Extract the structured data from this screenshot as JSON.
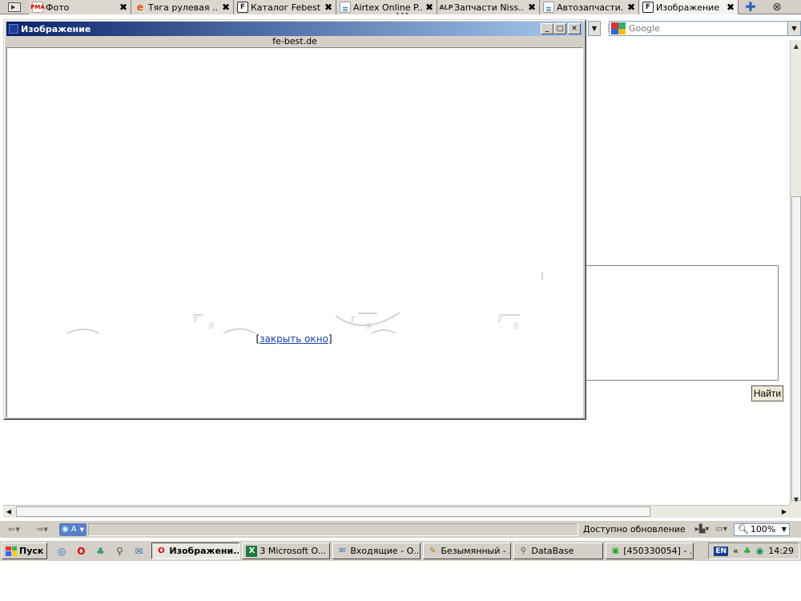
{
  "tabs": [
    {
      "icon": "pma-icon",
      "icon_text": "PMA",
      "label": "Фото",
      "width": 0
    },
    {
      "icon": "ie-icon",
      "icon_text": "e",
      "label": "Тяга рулевая ..."
    },
    {
      "icon": "febest-icon",
      "icon_text": "F",
      "label": "Каталог Febest"
    },
    {
      "icon": "document-icon",
      "icon_text": "",
      "label": "Airtex Online P..."
    },
    {
      "icon": "alp-icon",
      "icon_text": "ALP",
      "label": "Запчасти Niss..."
    },
    {
      "icon": "document-icon",
      "icon_text": "",
      "label": "Автозапчасти..."
    },
    {
      "icon": "febest-icon",
      "icon_text": "F",
      "label": "Изображение"
    }
  ],
  "tab_close_glyph": "✖",
  "tab_add_glyph": "✚",
  "tab_menu_glyph": "⊗",
  "tab_dots": "•••",
  "search": {
    "value": "Google"
  },
  "popup": {
    "title": "Изображение",
    "url": "fe-best.de",
    "link_open": "[",
    "link_text": "закрыть окно",
    "link_close": "]"
  },
  "page": {
    "find_button": "Найти"
  },
  "statusbar": {
    "mode_label": "A",
    "update_text": "Доступно обновление",
    "zoom": "100%"
  },
  "taskbar": {
    "start_label": "Пуск",
    "tasks": [
      {
        "icon": "opera-icon",
        "icon_text": "O",
        "label": "Изображени...",
        "active": true
      },
      {
        "icon": "excel-icon",
        "icon_text": "X",
        "label": "3 Microsoft O... ▾",
        "active": false
      },
      {
        "icon": "mail-icon",
        "icon_text": "✉",
        "label": "Входящие - О...",
        "active": false
      },
      {
        "icon": "paint-icon",
        "icon_text": "✎",
        "label": "Безымянный - ...",
        "active": false
      },
      {
        "icon": "database-icon",
        "icon_text": "⚲",
        "label": "DataBase",
        "active": false
      },
      {
        "icon": "app-icon",
        "icon_text": "▣",
        "label": "[450330054] - ...",
        "active": false
      }
    ],
    "lang": "EN",
    "clock": "14:29"
  },
  "colors": {
    "titlebar_start": "#0a246a",
    "titlebar_end": "#a6caf0",
    "link": "#1a3fa8",
    "chrome": "#d4d0c8"
  }
}
